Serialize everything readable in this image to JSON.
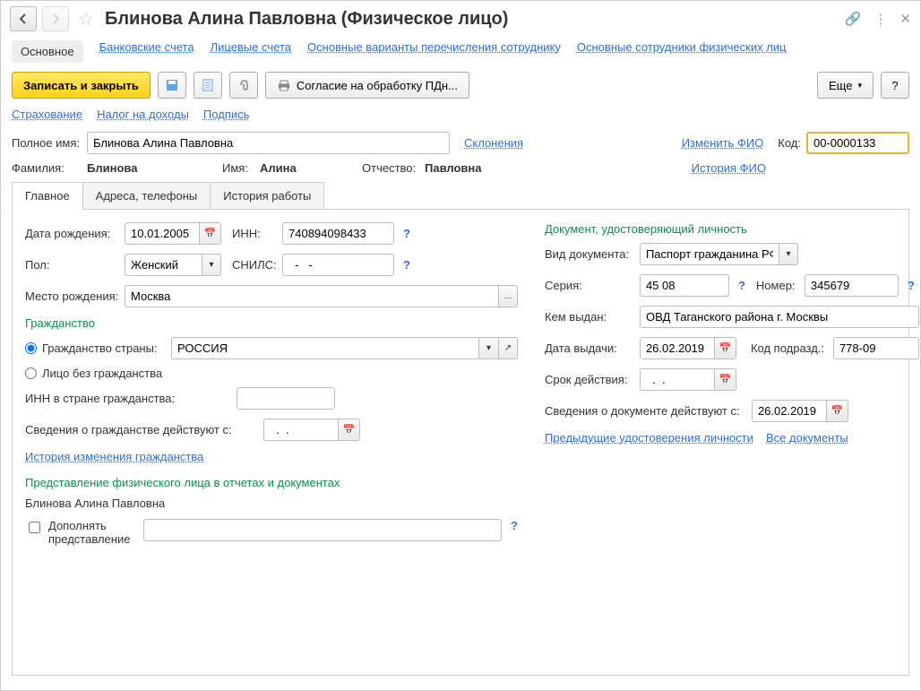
{
  "title": "Блинова Алина Павловна (Физическое лицо)",
  "subnav": {
    "main": "Основное",
    "bank": "Банковские счета",
    "personal_acc": "Лицевые счета",
    "transfer": "Основные варианты перечисления сотруднику",
    "employees": "Основные сотрудники физических лиц"
  },
  "toolbar": {
    "save_close": "Записать и закрыть",
    "consent": "Согласие на обработку ПДн...",
    "more": "Еще",
    "help": "?"
  },
  "links": {
    "insurance": "Страхование",
    "tax": "Налог на доходы",
    "signature": "Подпись"
  },
  "header": {
    "fullname_label": "Полное имя:",
    "fullname": "Блинова Алина Павловна",
    "declensions": "Склонения",
    "surname_label": "Фамилия:",
    "surname": "Блинова",
    "name_label": "Имя:",
    "name": "Алина",
    "patronymic_label": "Отчество:",
    "patronymic": "Павловна",
    "change_fio": "Изменить ФИО",
    "history_fio": "История ФИО",
    "code_label": "Код:",
    "code": "00-0000133"
  },
  "tabs": {
    "main": "Главное",
    "addresses": "Адреса, телефоны",
    "history": "История работы"
  },
  "left": {
    "birth_label": "Дата рождения:",
    "birth": "10.01.2005",
    "inn_label": "ИНН:",
    "inn": "740894098433",
    "gender_label": "Пол:",
    "gender": "Женский",
    "snils_label": "СНИЛС:",
    "snils": "  -   -",
    "birthplace_label": "Место рождения:",
    "birthplace": "Москва",
    "citizenship_title": "Гражданство",
    "citizenship_country_label": "Гражданство страны:",
    "citizenship_country": "РОССИЯ",
    "stateless_label": "Лицо без гражданства",
    "foreign_inn_label": "ИНН в стране гражданства:",
    "citizenship_from_label": "Сведения о гражданстве действуют с:",
    "citizenship_from": "  .  .",
    "citizenship_history": "История изменения гражданства",
    "repr_title": "Представление физического лица в отчетах и документах",
    "repr_value": "Блинова Алина Павловна",
    "supplement_label": "Дополнять представление"
  },
  "right": {
    "doc_title": "Документ, удостоверяющий личность",
    "doc_type_label": "Вид документа:",
    "doc_type": "Паспорт гражданина РФ",
    "series_label": "Серия:",
    "series": "45 08",
    "number_label": "Номер:",
    "number": "345679",
    "issued_by_label": "Кем выдан:",
    "issued_by": "ОВД Таганского района г. Москвы",
    "issue_date_label": "Дата выдачи:",
    "issue_date": "26.02.2019",
    "dept_code_label": "Код подразд.:",
    "dept_code": "778-09",
    "valid_until_label": "Срок действия:",
    "valid_until": "  .  .",
    "doc_from_label": "Сведения о документе действуют с:",
    "doc_from": "26.02.2019",
    "prev_docs": "Предыдущие удостоверения личности",
    "all_docs": "Все документы"
  }
}
